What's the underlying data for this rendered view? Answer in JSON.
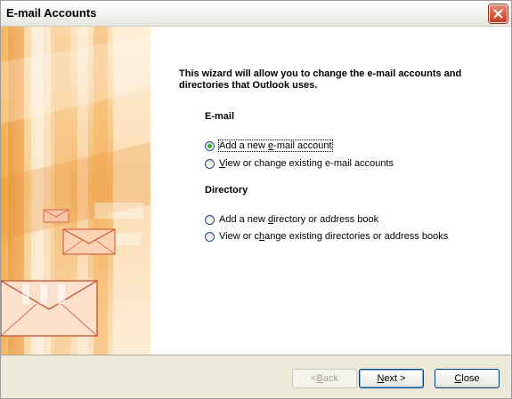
{
  "window": {
    "title": "E-mail Accounts",
    "close_icon": "close-icon"
  },
  "colors": {
    "title_close_bg": "#c2391d",
    "radio_checked": "#2bb03a",
    "art_accent": "#e07b1e",
    "footer_bg": "#ece9d8"
  },
  "main": {
    "intro": "This wizard will allow you to change the e-mail accounts and directories that Outlook uses.",
    "email_section": {
      "label": "E-mail",
      "options": [
        {
          "pre": "Add a new ",
          "key": "e",
          "post": "-mail account",
          "checked": true
        },
        {
          "pre": "",
          "key": "V",
          "post": "iew or change existing e-mail accounts",
          "checked": false
        }
      ]
    },
    "directory_section": {
      "label": "Directory",
      "options": [
        {
          "pre": "Add a new ",
          "key": "d",
          "post": "irectory or address book",
          "checked": false
        },
        {
          "pre": "View or c",
          "key": "h",
          "post": "ange existing directories or address books",
          "checked": false
        }
      ]
    }
  },
  "footer": {
    "back": {
      "pre": "< ",
      "key": "B",
      "post": "ack",
      "enabled": false
    },
    "next": {
      "pre": "",
      "key": "N",
      "post": "ext >",
      "enabled": true
    },
    "close": {
      "pre": "",
      "key": "C",
      "post": "lose",
      "enabled": true
    }
  }
}
